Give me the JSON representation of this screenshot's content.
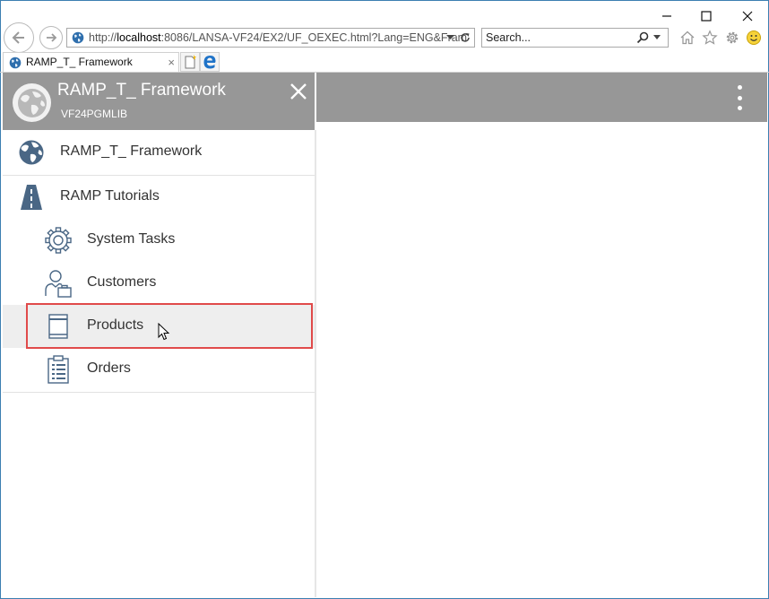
{
  "browser": {
    "address": {
      "prefix": "http://",
      "host": "localhost",
      "rest": ":8086/LANSA-VF24/EX2/UF_OEXEC.html?Lang=ENG&Fram"
    },
    "search_placeholder": "Search...",
    "tab_title": "RAMP_T_ Framework",
    "tab_close": "×"
  },
  "drawer": {
    "title": "RAMP_T_ Framework",
    "subtitle": "VF24PGMLIB"
  },
  "nav": {
    "items": [
      {
        "label": "RAMP_T_ Framework",
        "icon": "globe-icon"
      },
      {
        "label": "RAMP Tutorials",
        "icon": "road-icon"
      },
      {
        "label": "System Tasks",
        "icon": "gear-icon"
      },
      {
        "label": "Customers",
        "icon": "customer-icon"
      },
      {
        "label": "Products",
        "icon": "product-icon"
      },
      {
        "label": "Orders",
        "icon": "clipboard-icon"
      }
    ],
    "selected": "Products"
  },
  "colors": {
    "header_gray": "#979797",
    "icon_blue": "#4a6785",
    "highlight_red": "#e04a4a",
    "selected_bg": "#eeeeee"
  }
}
